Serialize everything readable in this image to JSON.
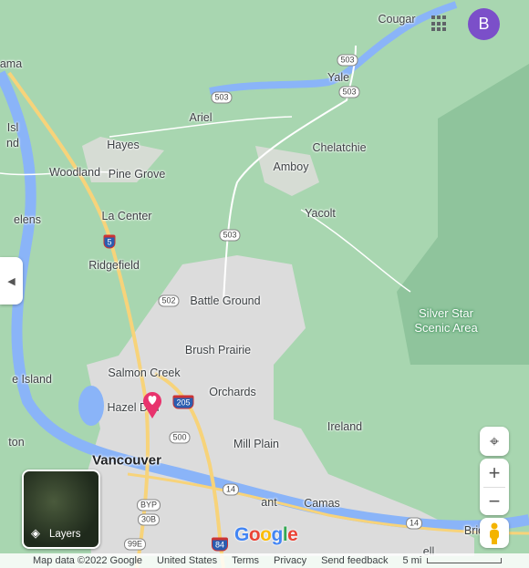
{
  "map": {
    "places": [
      "Cougar",
      "Yale",
      "Ariel",
      "Hayes",
      "Chelatchie",
      "Woodland",
      "Pine Grove",
      "Amboy",
      "La Center",
      "Yacolt",
      "Ridgefield",
      "Battle Ground",
      "Brush Prairie",
      "Salmon Creek",
      "Orchards",
      "Hazel Dell",
      "Ireland",
      "Mill Plain",
      "Camas",
      "ama",
      "Isl",
      "nd",
      "elens",
      "e Island",
      "ton",
      "ant",
      "Brid",
      "ell"
    ],
    "city": "Vancouver",
    "park": [
      "Silver Star",
      "Scenic Area"
    ],
    "shields": [
      "503",
      "503",
      "503",
      "503",
      "5",
      "502",
      "205",
      "500",
      "14",
      "14",
      "BYP",
      "30B",
      "99E",
      "84"
    ],
    "colors": {
      "land": "#a8d6b0",
      "urban": "#dcdcdc",
      "water": "#8ab4f8",
      "highway": "#f7d37a",
      "park": "#8fc49c",
      "pin": "#e8336d",
      "avatar": "#7b4fc9"
    }
  },
  "pin_icon": "heart-pin-icon",
  "header": {
    "avatar_letter": "B",
    "apps_icon": "apps-grid-icon"
  },
  "controls": {
    "locate_icon": "my-location-icon",
    "zoom_in": "+",
    "zoom_out": "−",
    "pegman_icon": "street-view-pegman-icon",
    "collapse_icon": "chevron-left-icon"
  },
  "layers": {
    "label": "Layers"
  },
  "logo": "Google",
  "footer": {
    "map_data": "Map data ©2022 Google",
    "region": "United States",
    "terms": "Terms",
    "privacy": "Privacy",
    "feedback": "Send feedback",
    "scale": "5 mi"
  }
}
